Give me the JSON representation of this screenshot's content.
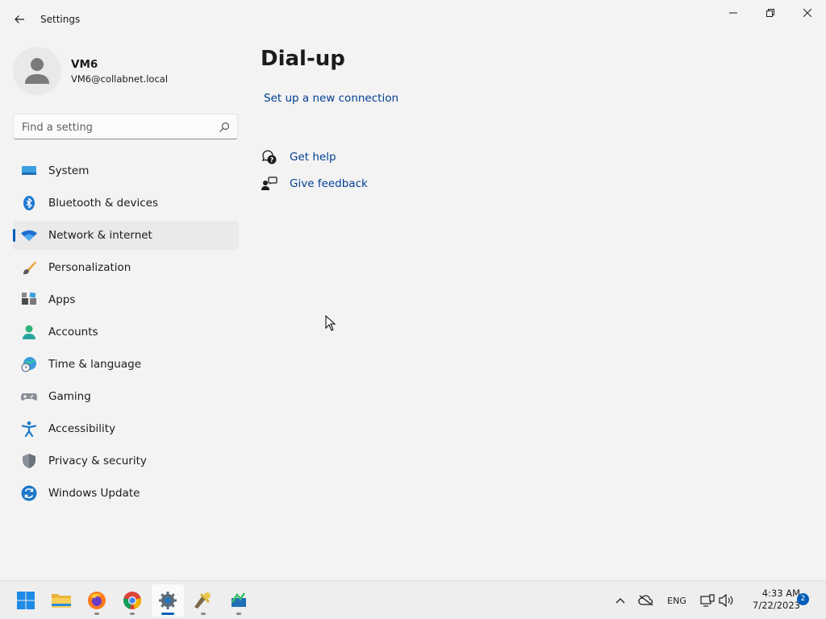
{
  "window": {
    "title": "Settings"
  },
  "profile": {
    "name": "VM6",
    "email": "VM6@collabnet.local"
  },
  "search": {
    "placeholder": "Find a setting"
  },
  "nav": {
    "items": [
      {
        "label": "System",
        "icon": "monitor-icon"
      },
      {
        "label": "Bluetooth & devices",
        "icon": "bluetooth-icon"
      },
      {
        "label": "Network & internet",
        "icon": "wifi-icon",
        "active": true
      },
      {
        "label": "Personalization",
        "icon": "brush-icon"
      },
      {
        "label": "Apps",
        "icon": "apps-icon"
      },
      {
        "label": "Accounts",
        "icon": "person-icon"
      },
      {
        "label": "Time & language",
        "icon": "globe-clock-icon"
      },
      {
        "label": "Gaming",
        "icon": "gamepad-icon"
      },
      {
        "label": "Accessibility",
        "icon": "accessibility-icon"
      },
      {
        "label": "Privacy & security",
        "icon": "shield-icon"
      },
      {
        "label": "Windows Update",
        "icon": "update-icon"
      }
    ]
  },
  "content": {
    "title": "Dial-up",
    "setup_link": "Set up a new connection",
    "help": {
      "get_help": "Get help",
      "give_feedback": "Give feedback"
    }
  },
  "taskbar": {
    "apps": [
      "start-icon",
      "file-explorer-icon",
      "firefox-icon",
      "chrome-icon",
      "settings-icon",
      "app-icon",
      "app-icon"
    ],
    "tray": {
      "language": "ENG",
      "time": "4:33 AM",
      "date": "7/22/2023",
      "notification_count": "2"
    }
  },
  "colors": {
    "accent": "#005fb8",
    "link": "#003e92",
    "background": "#f3f3f3"
  }
}
